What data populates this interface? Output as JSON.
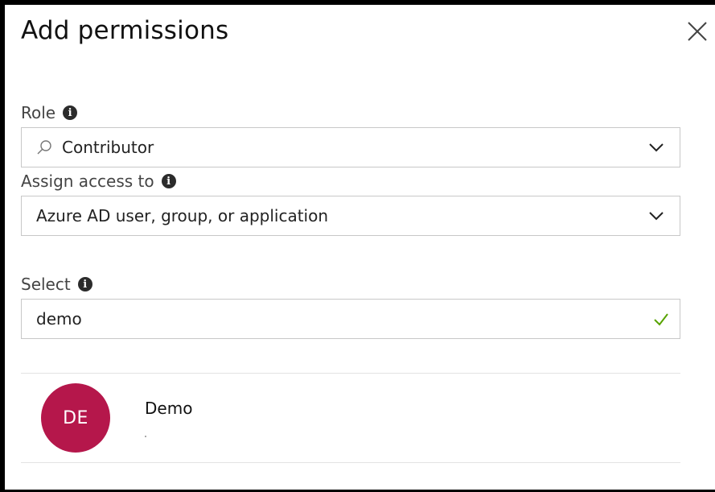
{
  "panel": {
    "title": "Add permissions"
  },
  "role": {
    "label": "Role",
    "value": "Contributor"
  },
  "assign_access": {
    "label": "Assign access to",
    "value": "Azure AD user, group, or application"
  },
  "select": {
    "label": "Select",
    "value": "demo"
  },
  "results": [
    {
      "initials": "DE",
      "name": "Demo",
      "avatar_color": "#b5174b"
    }
  ],
  "colors": {
    "valid_check": "#57a300",
    "avatar": "#b5174b"
  }
}
